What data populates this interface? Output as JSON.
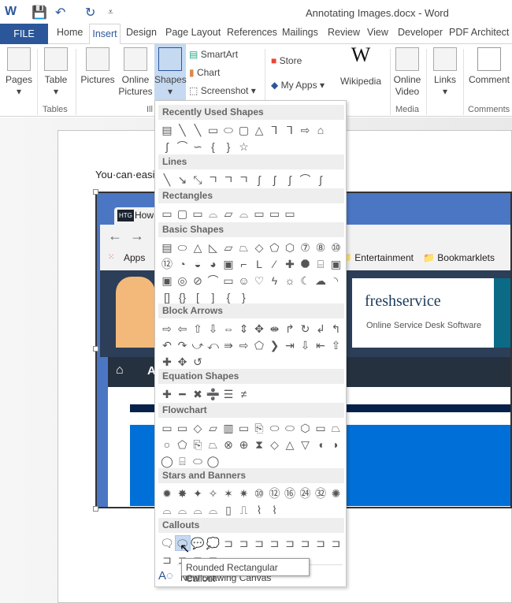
{
  "titlebar": {
    "title": "Annotating Images.docx - Word"
  },
  "tabs": {
    "file": "FILE",
    "items": [
      "Home",
      "Insert",
      "Design",
      "Page Layout",
      "References",
      "Mailings",
      "Review",
      "View",
      "Developer",
      "PDF Architect 3"
    ]
  },
  "ribbon": {
    "pages": "Pages",
    "table": "Table",
    "pictures": "Pictures",
    "online_pictures_1": "Online",
    "online_pictures_2": "Pictures",
    "shapes": "Shapes",
    "smartart": "SmartArt",
    "chart": "Chart",
    "screenshot": "Screenshot",
    "store": "Store",
    "my_apps": "My Apps",
    "wikipedia": "Wikipedia",
    "online_video_1": "Online",
    "online_video_2": "Video",
    "links": "Links",
    "comment": "Comment",
    "groups": {
      "tables": "Tables",
      "illustrations": "Ill",
      "media": "Media",
      "comments": "Comments"
    }
  },
  "document": {
    "text": "You·can·easi",
    "browser": {
      "tab": "How-",
      "tab_icon": "HTG",
      "apps": "Apps",
      "bookmarks": [
        "Entertainment",
        "Bookmarklets"
      ],
      "ad_brand": "freshservice",
      "ad_tagline": "Online Service Desk Software",
      "nav_letter": "A"
    }
  },
  "shapes_menu": {
    "sections": [
      {
        "title": "Recently Used Shapes",
        "rows": [
          [
            "▤",
            "╲",
            "╲",
            "▭",
            "⬭",
            "▢",
            "△",
            "⅂",
            "⅂",
            "⇨",
            "⌂"
          ],
          [
            "ʃ",
            "⌒",
            "∽",
            "{",
            "}",
            "☆"
          ]
        ]
      },
      {
        "title": "Lines",
        "rows": [
          [
            "╲",
            "↘",
            "⤡",
            "ㄱ",
            "ㄱ",
            "ㄱ",
            "ʃ",
            "ʃ",
            "ʃ",
            "⌒",
            "ʃ"
          ]
        ]
      },
      {
        "title": "Rectangles",
        "rows": [
          [
            "▭",
            "▢",
            "▭",
            "⌓",
            "▱",
            "⌓",
            "▭",
            "▭",
            "▭"
          ]
        ]
      },
      {
        "title": "Basic Shapes",
        "rows": [
          [
            "▤",
            "⬭",
            "△",
            "◺",
            "▱",
            "⏢",
            "◇",
            "⬠",
            "⬡",
            "⑦",
            "⑧",
            "⑩"
          ],
          [
            "⑫",
            "◔",
            "◒",
            "◕",
            "▣",
            "⌐",
            "L",
            "⁄",
            "✚",
            "⯃",
            "⌸",
            "▣"
          ],
          [
            "▣",
            "◎",
            "⊘",
            "⌒",
            "▭",
            "☺",
            "♡",
            "ϟ",
            "☼",
            "☾",
            "☁",
            "◝"
          ],
          [
            "[]",
            "{}",
            "[",
            "]",
            "{",
            "}"
          ]
        ]
      },
      {
        "title": "Block Arrows",
        "rows": [
          [
            "⇨",
            "⇦",
            "⇧",
            "⇩",
            "⇔",
            "⇕",
            "✥",
            "⇼",
            "↱",
            "↻",
            "↲",
            "↰"
          ],
          [
            "↶",
            "↷",
            "⤻",
            "⤺",
            "⇛",
            "⇨",
            "⬠",
            "❯",
            "⇥",
            "⇩",
            "⇤",
            "⇧"
          ],
          [
            "✚",
            "✥",
            "↺"
          ]
        ]
      },
      {
        "title": "Equation Shapes",
        "rows": [
          [
            "✚",
            "━",
            "✖",
            "➗",
            "☰",
            "≠"
          ]
        ]
      },
      {
        "title": "Flowchart",
        "rows": [
          [
            "▭",
            "▭",
            "◇",
            "▱",
            "▥",
            "▭",
            "⎘",
            "⬭",
            "⬭",
            "⬡",
            "▭",
            "⏢"
          ],
          [
            "○",
            "⬠",
            "⎘",
            "⏢",
            "⊗",
            "⊕",
            "⧗",
            "◇",
            "△",
            "▽",
            "◖",
            "◗"
          ],
          [
            "◯",
            "⌸",
            "⬭",
            "◯"
          ]
        ]
      },
      {
        "title": "Stars and Banners",
        "rows": [
          [
            "✹",
            "✸",
            "✦",
            "✧",
            "✶",
            "✷",
            "⑩",
            "⑫",
            "⑯",
            "㉔",
            "㉜",
            "✺"
          ],
          [
            "⌓",
            "⌓",
            "⌓",
            "⌓",
            "▯",
            "⎍",
            "⌇",
            "⌇"
          ]
        ]
      },
      {
        "title": "Callouts",
        "rows": [
          [
            "🗨",
            "🗨",
            "💬",
            "💭",
            "⊐",
            "⊐",
            "⊐",
            "⊐",
            "⊐",
            "⊐",
            "⊐",
            "⊐"
          ],
          [
            "⊐",
            "⊐",
            "⊐",
            "⊐"
          ]
        ]
      }
    ],
    "highlighted": "Rounded Rectangular Callout",
    "new_canvas": "New Drawing Canvas"
  },
  "colors": {
    "accent": "#2b579a",
    "highlight": "#c5d9f1"
  }
}
